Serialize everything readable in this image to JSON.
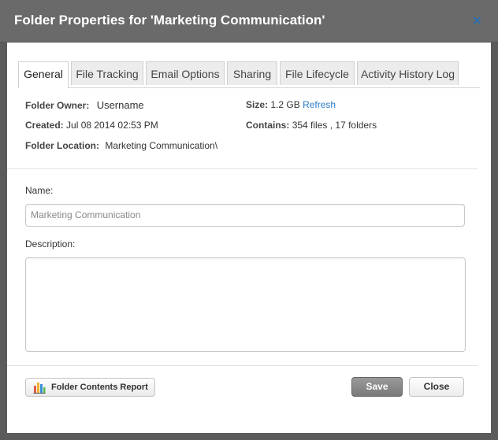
{
  "window": {
    "title": "Folder Properties for 'Marketing Communication'",
    "close_glyph": "×"
  },
  "tabs": [
    {
      "label": "General",
      "active": true
    },
    {
      "label": "File Tracking",
      "active": false
    },
    {
      "label": "Email Options",
      "active": false
    },
    {
      "label": "Sharing",
      "active": false
    },
    {
      "label": "File Lifecycle",
      "active": false
    },
    {
      "label": "Activity History Log",
      "active": false
    }
  ],
  "info": {
    "owner_label": "Folder Owner:",
    "owner_value": "Username",
    "created_label": "Created:",
    "created_value": "Jul 08 2014 02:53 PM",
    "location_label": "Folder Location:",
    "location_value": "Marketing Communication\\",
    "size_label": "Size:",
    "size_value": "1.2 GB",
    "refresh_link": "Refresh",
    "contains_label": "Contains:",
    "contains_value": "354 files , 17 folders"
  },
  "form": {
    "name_label": "Name:",
    "name_value": "Marketing Communication",
    "description_label": "Description:",
    "description_value": ""
  },
  "buttons": {
    "report_label": "Folder Contents Report",
    "save_label": "Save",
    "close_label": "Close"
  },
  "colors": {
    "accent_link": "#2a7cc7",
    "titlebar": "#6a6a6a",
    "save_button": "#8a8a8a"
  }
}
